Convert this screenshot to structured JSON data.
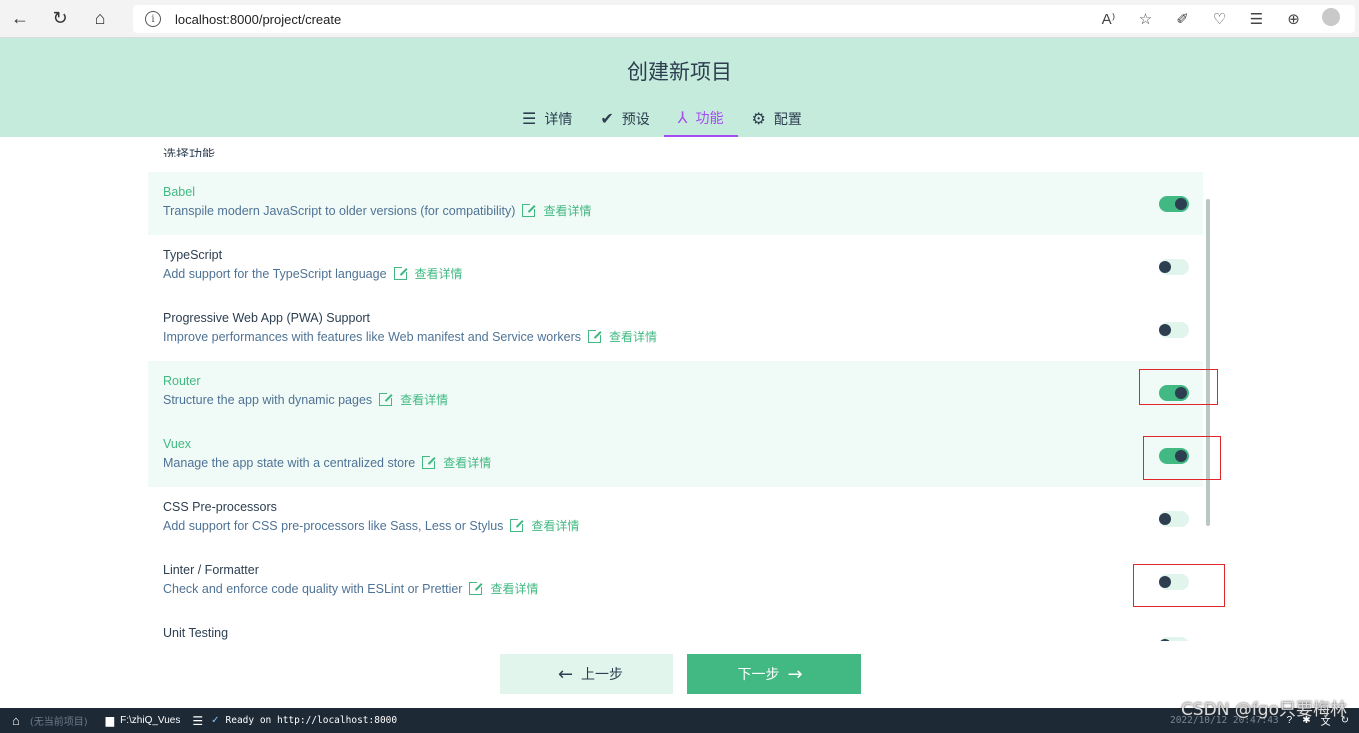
{
  "browser": {
    "url": "localhost:8000/project/create",
    "info_symbol": "i"
  },
  "header": {
    "title": "创建新项目",
    "tabs": [
      {
        "label": "详情",
        "icon": "list-icon",
        "active": false
      },
      {
        "label": "预设",
        "icon": "check-circle-icon",
        "active": false
      },
      {
        "label": "功能",
        "icon": "fork-icon",
        "active": true
      },
      {
        "label": "配置",
        "icon": "gear-icon",
        "active": false
      }
    ]
  },
  "content": {
    "section_label_cut": "选择功能",
    "more_link": "查看详情",
    "features": [
      {
        "name": "Babel",
        "desc": "Transpile modern JavaScript to older versions (for compatibility)",
        "enabled": true
      },
      {
        "name": "TypeScript",
        "desc": "Add support for the TypeScript language",
        "enabled": false
      },
      {
        "name": "Progressive Web App (PWA) Support",
        "desc": "Improve performances with features like Web manifest and Service workers",
        "enabled": false
      },
      {
        "name": "Router",
        "desc": "Structure the app with dynamic pages",
        "enabled": true
      },
      {
        "name": "Vuex",
        "desc": "Manage the app state with a centralized store",
        "enabled": true
      },
      {
        "name": "CSS Pre-processors",
        "desc": "Add support for CSS pre-processors like Sass, Less or Stylus",
        "enabled": false
      },
      {
        "name": "Linter / Formatter",
        "desc": "Check and enforce code quality with ESLint or Prettier",
        "enabled": false
      },
      {
        "name": "Unit Testing",
        "desc": "",
        "enabled": false
      }
    ]
  },
  "footer": {
    "prev_label": "上一步",
    "next_label": "下一步",
    "prev_arrow": "←",
    "next_arrow": "→"
  },
  "status": {
    "no_project": "(无当前项目)",
    "folder": "F:\\zhiQ_Vues",
    "message": "Ready on http://localhost:8000",
    "datetime": "2022/10/12 20:47:43",
    "watermark": "CSDN @fgo只要梅林"
  }
}
